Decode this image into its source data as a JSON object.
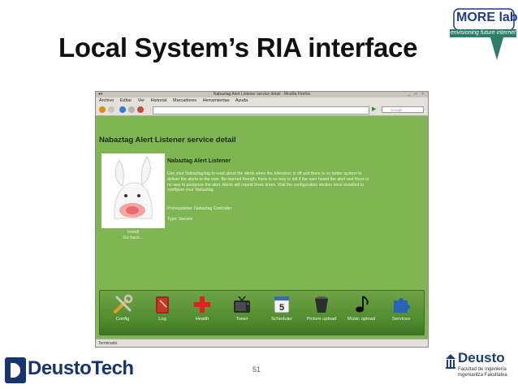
{
  "slide": {
    "title": "Local System’s RIA interface",
    "page_number": "51"
  },
  "logos": {
    "morelab_name": "MORE lab",
    "morelab_tagline": "envisioning future internet",
    "deustotech_name": "DeustoTech",
    "deusto_name": "Deusto",
    "deusto_sub1": "Facultad de Ingeniería",
    "deusto_sub2": "Ingeniaritza Fakultatea"
  },
  "browser": {
    "window_title": "Nabaztag Alert Listener service detail - Mozilla Firefox",
    "menu": [
      "Archivo",
      "Editar",
      "Ver",
      "Historial",
      "Marcadores",
      "Herramientas",
      "Ayuda"
    ],
    "search_placeholder": "Google",
    "status": "Terminado"
  },
  "page": {
    "heading": "Nabaztag Alert Listener service detail",
    "service_title": "Nabaztag Alert Listener",
    "description": "Use your Nabaztag/tag to read aloud the alerts when the television is off and there is no better system to deliver the alerts to the user. Be warned though, there is no way to tell if the user heard the alert and there is no way to postpone the alert. Alerts will repeat three times. Visit the configuration section once installed to configure your Nabaztag.",
    "prerequisites": "Prerequisites: Nabaztag Controller",
    "type": "Type: Service",
    "install_link": "Install",
    "back_link": "Go back..."
  },
  "dock": [
    {
      "label": "Config",
      "icon": "tools-icon"
    },
    {
      "label": "Log",
      "icon": "book-icon"
    },
    {
      "label": "Health",
      "icon": "red-cross-icon"
    },
    {
      "label": "Tuner",
      "icon": "tv-icon"
    },
    {
      "label": "Scheduler",
      "icon": "calendar-icon",
      "badge": "5"
    },
    {
      "label": "Picture upload",
      "icon": "bucket-icon"
    },
    {
      "label": "Music upload",
      "icon": "music-note-icon"
    },
    {
      "label": "Services",
      "icon": "puzzle-icon"
    }
  ],
  "colors": {
    "page_bg": "#7fb552",
    "dock_bg": "#4f8a2e",
    "brand_blue": "#15356b"
  }
}
